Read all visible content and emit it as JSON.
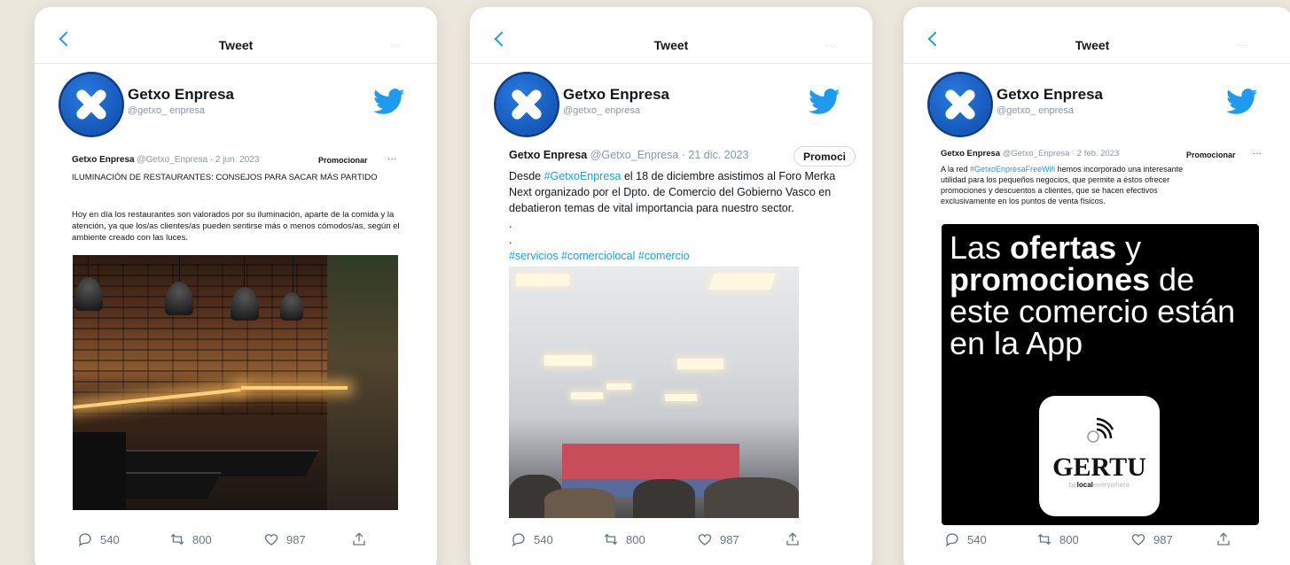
{
  "colors": {
    "accent": "#1d9bf0",
    "background": "#ece7dc"
  },
  "cards": [
    {
      "topbar": {
        "title": "Tweet",
        "more": "···"
      },
      "profile": {
        "name": "Getxo Enpresa",
        "handle": "@getxo_ enpresa"
      },
      "tweet": {
        "author": "Getxo Enpresa",
        "meta": "@Getxo_Enpresa · 2 jun. 2023",
        "promote": "Promocionar",
        "more": "···",
        "headline": "ILUMINACIÓN DE RESTAURANTES: CONSEJOS PARA SACAR MÁS PARTIDO",
        "body": "Hoy en día los restaurantes son valorados por su iluminación, aparte de la comida y la atención, ya que los/as clientes/as pueden sentirse más o menos cómodos/as, según el ambiente creado con las luces."
      },
      "actions": {
        "replies": "540",
        "retweets": "800",
        "likes": "987"
      }
    },
    {
      "topbar": {
        "title": "Tweet",
        "more": "···"
      },
      "profile": {
        "name": "Getxo Enpresa",
        "handle": "@getxo_ enpresa"
      },
      "tweet": {
        "author": "Getxo Enpresa",
        "meta": "@Getxo_Enpresa · 21 dic. 2023",
        "promote": "Promoci",
        "line1_pre": "Desde ",
        "line1_tag": "#GetxoEnpresa",
        "line1_post": " el 18 de diciembre asistimos al Foro Merka",
        "line2": "Next organizado por el Dpto. de Comercio del Gobierno Vasco en",
        "line3": "debatieron temas de vital importancia para nuestro sector.",
        "dot": ".",
        "hashtags": "#servicios #comerciolocal #comercio"
      },
      "actions": {
        "replies": "540",
        "retweets": "800",
        "likes": "987"
      }
    },
    {
      "topbar": {
        "title": "Tweet",
        "more": "···"
      },
      "profile": {
        "name": "Getxo Enpresa",
        "handle": "@getxo_ enpresa"
      },
      "tweet": {
        "author": "Getxo Enpresa",
        "meta": "@Getxo_Enpresa · 2 feb. 2023",
        "promote": "Promocionar",
        "more": "···",
        "line1_pre": "A la red ",
        "line1_tag": "#GetxoEnpresaFreeWifi",
        "line1_post": " hemos incorporado una interesante",
        "line2": "utilidad para los pequeños negocios, que permite a éstos ofrecer",
        "line3": "promociones y descuentos a clientes, que se hacen efectivos",
        "line4": "exclusivamente en los puntos de venta físicos."
      },
      "image": {
        "l1_a": "Las ",
        "l1_b": "ofertas",
        "l1_c": " y",
        "l2_a": "promociones",
        "l2_b": " de",
        "l3": "este comercio están",
        "l4": "en la App",
        "brand": "GERTU",
        "tag_pre": "be",
        "tag_bold": "local",
        "tag_post": "everywhere"
      },
      "actions": {
        "replies": "540",
        "retweets": "800",
        "likes": "987"
      }
    }
  ]
}
